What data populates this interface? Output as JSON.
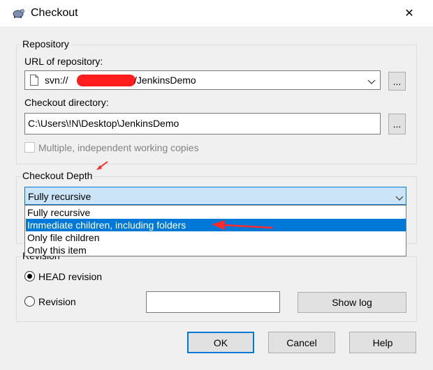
{
  "window": {
    "title": "Checkout",
    "close_glyph": "✕"
  },
  "repository": {
    "legend": "Repository",
    "url_label": "URL of repository:",
    "url_prefix": "svn://",
    "url_suffix": "/JenkinsDemo",
    "browse_label": "...",
    "dir_label": "Checkout directory:",
    "dir_value": "C:\\Users\\!N\\Desktop\\JenkinsDemo",
    "dir_browse_label": "...",
    "multiple_label": "Multiple, independent working copies",
    "multiple_checked": false
  },
  "depth": {
    "legend": "Checkout Depth",
    "selected": "Fully recursive",
    "options": [
      "Fully recursive",
      "Immediate children, including folders",
      "Only file children",
      "Only this item"
    ],
    "highlighted_index": 1
  },
  "revision": {
    "legend": "Revision",
    "head_label": "HEAD revision",
    "revision_label": "Revision",
    "revision_value": "",
    "show_log_label": "Show log",
    "selected": "HEAD revision"
  },
  "buttons": {
    "ok": "OK",
    "cancel": "Cancel",
    "help": "Help"
  },
  "annotation_color": "#ff2a2a"
}
